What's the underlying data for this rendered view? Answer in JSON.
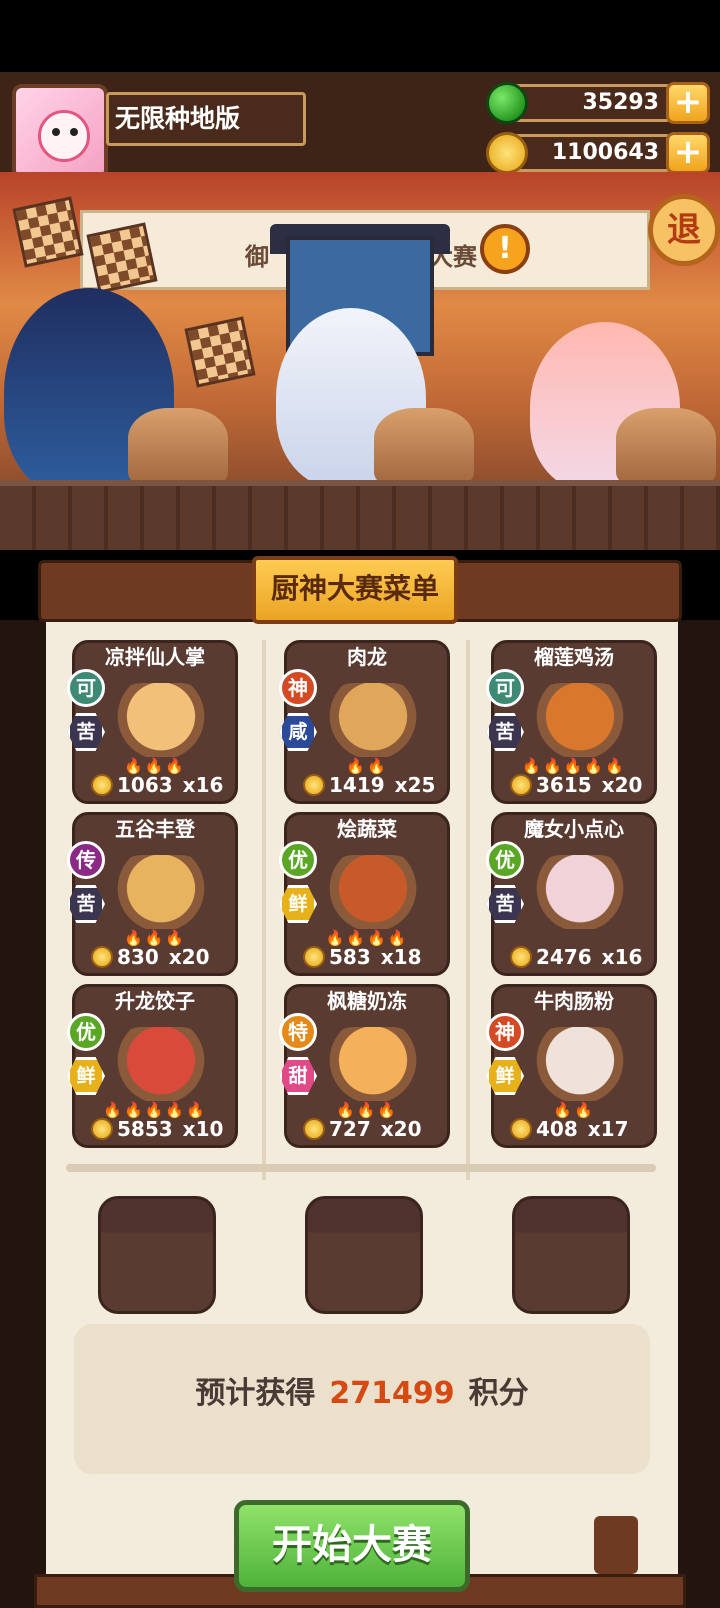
{
  "player": {
    "name": "无限种地版"
  },
  "currencies": [
    {
      "id": "jade",
      "value": "35293",
      "icon": "jade-icon",
      "plus": "+"
    },
    {
      "id": "coin",
      "value": "1100643",
      "icon": "coin-icon",
      "plus": "+"
    }
  ],
  "stage": {
    "banner_left": "御",
    "banner_right": "大赛",
    "alert": "!",
    "exit_label": "退"
  },
  "menu": {
    "title": "厨神大赛菜单",
    "dishes": [
      {
        "name": "凉拌仙人掌",
        "grade": "可",
        "taste": "苦",
        "price": "1063",
        "qty": "x16",
        "flames": "🔥🔥🔥",
        "plate_color": "#f3c07a"
      },
      {
        "name": "肉龙",
        "grade": "神",
        "taste": "咸",
        "price": "1419",
        "qty": "x25",
        "flames": "🔥🔥",
        "plate_color": "#e0a65a"
      },
      {
        "name": "榴莲鸡汤",
        "grade": "可",
        "taste": "苦",
        "price": "3615",
        "qty": "x20",
        "flames": "🔥🔥🔥🔥🔥",
        "plate_color": "#d9772c"
      },
      {
        "name": "五谷丰登",
        "grade": "传",
        "taste": "苦",
        "price": "830",
        "qty": "x20",
        "flames": "🔥🔥🔥",
        "plate_color": "#e8b35f"
      },
      {
        "name": "烩蔬菜",
        "grade": "优",
        "taste": "鲜",
        "price": "583",
        "qty": "x18",
        "flames": "🔥🔥🔥🔥",
        "plate_color": "#c85a2a"
      },
      {
        "name": "魔女小点心",
        "grade": "优",
        "taste": "苦",
        "price": "2476",
        "qty": "x16",
        "flames": "",
        "plate_color": "#f0d2d8"
      },
      {
        "name": "升龙饺子",
        "grade": "优",
        "taste": "鲜",
        "price": "5853",
        "qty": "x10",
        "flames": "🔥🔥🔥🔥🔥",
        "plate_color": "#d94a3a"
      },
      {
        "name": "枫糖奶冻",
        "grade": "特",
        "taste": "甜",
        "price": "727",
        "qty": "x20",
        "flames": "🔥🔥🔥",
        "plate_color": "#f4b05a"
      },
      {
        "name": "牛肉肠粉",
        "grade": "神",
        "taste": "鲜",
        "price": "408",
        "qty": "x17",
        "flames": "🔥🔥",
        "plate_color": "#efe2da"
      }
    ]
  },
  "estimate": {
    "prefix": "预计获得",
    "value": "271499",
    "suffix": "积分"
  },
  "start_button": "开始大赛",
  "colors": {
    "accent_orange": "#d44a12",
    "start_green": "#4fb23a",
    "wood": "#6e3a22"
  }
}
